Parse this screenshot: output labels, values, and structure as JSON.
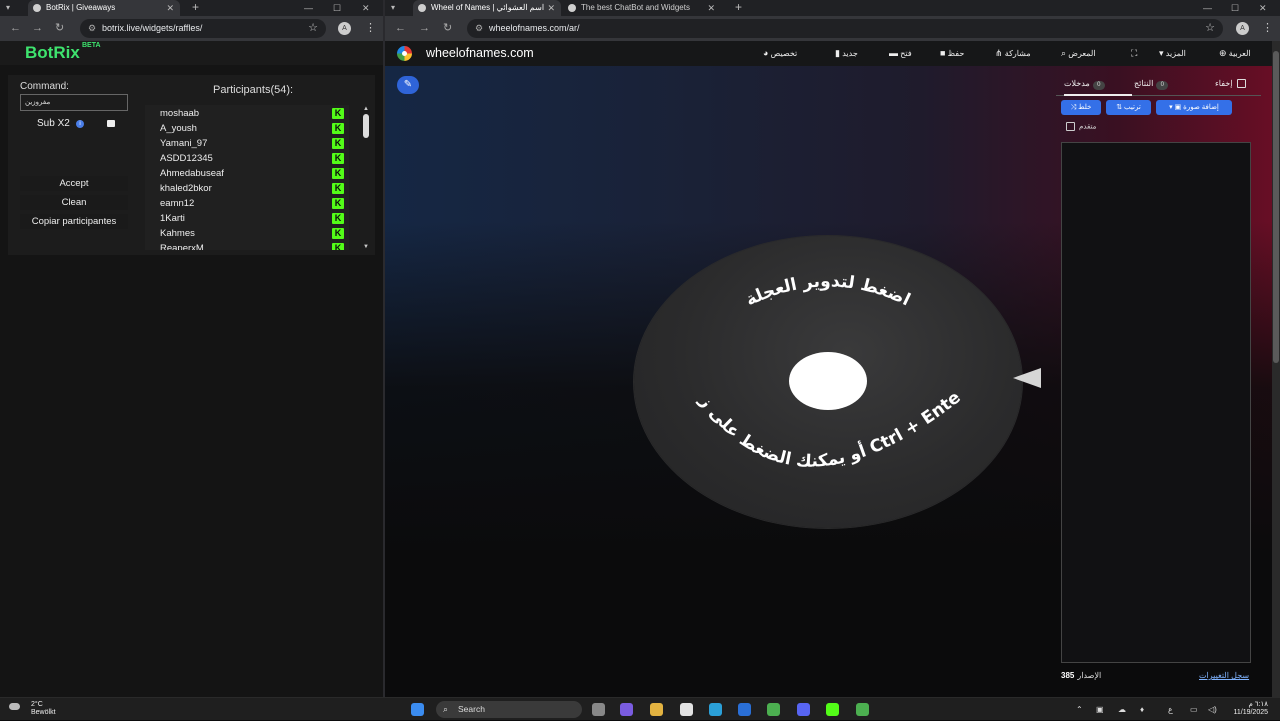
{
  "left_browser": {
    "tabs": [
      {
        "title": "BotRix | Giveaways",
        "active": true
      }
    ],
    "url": "botrix.live/widgets/raffles/",
    "profile_initial": "A"
  },
  "right_browser": {
    "tabs": [
      {
        "title": "Wheel of Names | اسم العشوائي",
        "active": true
      },
      {
        "title": "The best ChatBot and Widgets",
        "active": false
      }
    ],
    "url": "wheelofnames.com/ar/",
    "profile_initial": "A"
  },
  "botrix": {
    "logo": "BotRix",
    "beta": "BETA",
    "command_label": "Command:",
    "command_value": "مفروزين",
    "sub_label": "Sub X2",
    "sub_checked": true,
    "buttons": {
      "accept": "Accept",
      "clean": "Clean",
      "copy": "Copiar participantes"
    },
    "participants_title": "Participants(54):",
    "participants": [
      {
        "name": "moshaab",
        "platform": "K"
      },
      {
        "name": "A_yoush",
        "platform": "K"
      },
      {
        "name": "Yamani_97",
        "platform": "K"
      },
      {
        "name": "ASDD12345",
        "platform": "K"
      },
      {
        "name": "Ahmedabuseaf",
        "platform": "K"
      },
      {
        "name": "khaled2bkor",
        "platform": "K"
      },
      {
        "name": "eamn12",
        "platform": "K"
      },
      {
        "name": "1Karti",
        "platform": "K"
      },
      {
        "name": "Kahmes",
        "platform": "K"
      },
      {
        "name": "ReaperxM",
        "platform": "K"
      }
    ],
    "accent_color": "#3ee36e",
    "kick_color": "#53fc18"
  },
  "wheel_of_names": {
    "logo_text": "wheelofnames.com",
    "menu": {
      "customize": "تخصيص",
      "new": "جديد",
      "open": "فتح",
      "save": "حفظ",
      "share": "مشاركة",
      "gallery": "المعرض",
      "fullscreen": "",
      "more": "المزيد",
      "language": "العربية"
    },
    "wheel_text_top": "اضغط لتدوير العجلة",
    "wheel_text_bottom": "أو يمكنك الضغط على زر Ctrl + Enter",
    "side": {
      "hide_label": "إخفاء",
      "results_tab": "النتائج",
      "results_count": "0",
      "entries_tab": "مدخلات",
      "entries_count": "0",
      "btn_add_image": "إضافة صورة",
      "btn_sort": "ترتيب",
      "btn_shuffle": "خلط",
      "advanced": "متقدم",
      "changelog": "سجل التغييرات",
      "version_label": "الإصدار",
      "version_number": "385"
    }
  },
  "taskbar": {
    "weather_temp": "2°C",
    "weather_desc": "Bewölkt",
    "search_placeholder": "Search",
    "keyboard_lang": "ع",
    "time": "٦:١٨ م",
    "date": "11/19/2025"
  }
}
